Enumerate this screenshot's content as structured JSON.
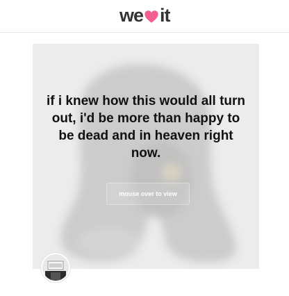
{
  "header": {
    "logo_before": "we",
    "logo_after": "it",
    "heart_color": "#f35e8f"
  },
  "post": {
    "quote": "if i knew how this would all turn out, i'd be more than happy to be dead and in heaven right now.",
    "mouse_over_label": "mouse over to view"
  },
  "avatar": {
    "icon": "user-avatar"
  }
}
